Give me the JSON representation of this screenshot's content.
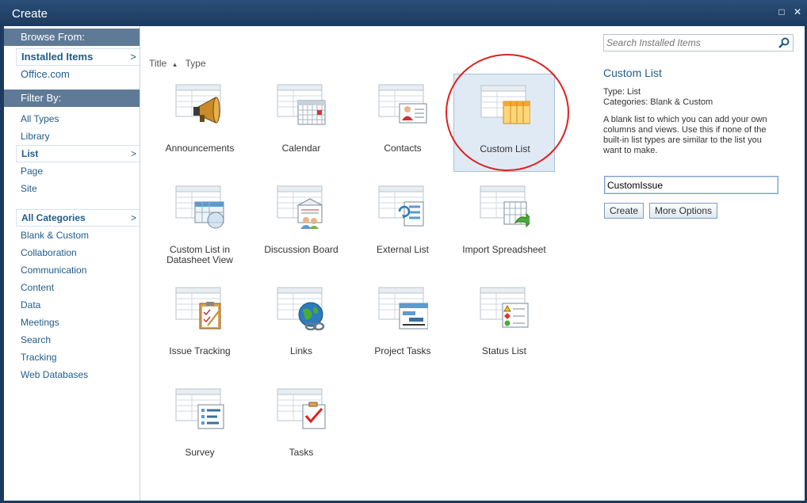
{
  "window": {
    "title": "Create",
    "maximize_glyph": "□",
    "close_glyph": "✕"
  },
  "nav": {
    "browse_header": "Browse From:",
    "browse": [
      {
        "label": "Installed Items",
        "selected": true
      },
      {
        "label": "Office.com",
        "selected": false
      }
    ],
    "filter_header": "Filter By:",
    "types": [
      {
        "label": "All Types",
        "selected": false
      },
      {
        "label": "Library",
        "selected": false
      },
      {
        "label": "List",
        "selected": true
      },
      {
        "label": "Page",
        "selected": false
      },
      {
        "label": "Site",
        "selected": false
      }
    ],
    "categories": [
      {
        "label": "All Categories",
        "selected": true
      },
      {
        "label": "Blank & Custom",
        "selected": false
      },
      {
        "label": "Collaboration",
        "selected": false
      },
      {
        "label": "Communication",
        "selected": false
      },
      {
        "label": "Content",
        "selected": false
      },
      {
        "label": "Data",
        "selected": false
      },
      {
        "label": "Meetings",
        "selected": false
      },
      {
        "label": "Search",
        "selected": false
      },
      {
        "label": "Tracking",
        "selected": false
      },
      {
        "label": "Web Databases",
        "selected": false
      }
    ],
    "chevron": ">"
  },
  "sort": {
    "title": "Title",
    "arrow": "▲",
    "type": "Type"
  },
  "tiles": [
    {
      "label": "Announcements",
      "icon": "megaphone-icon"
    },
    {
      "label": "Calendar",
      "icon": "calendar-icon"
    },
    {
      "label": "Contacts",
      "icon": "contact-card-icon"
    },
    {
      "label": "Custom List",
      "icon": "custom-list-icon",
      "selected": true
    },
    {
      "label": "Custom List in Datasheet View",
      "icon": "datasheet-icon"
    },
    {
      "label": "Discussion Board",
      "icon": "discussion-icon"
    },
    {
      "label": "External List",
      "icon": "external-list-icon"
    },
    {
      "label": "Import Spreadsheet",
      "icon": "spreadsheet-import-icon"
    },
    {
      "label": "Issue Tracking",
      "icon": "issue-clipboard-icon"
    },
    {
      "label": "Links",
      "icon": "globe-link-icon"
    },
    {
      "label": "Project Tasks",
      "icon": "gantt-icon"
    },
    {
      "label": "Status List",
      "icon": "status-indicator-icon"
    },
    {
      "label": "Survey",
      "icon": "survey-icon"
    },
    {
      "label": "Tasks",
      "icon": "task-checkbox-icon"
    }
  ],
  "details": {
    "search_placeholder": "Search Installed Items",
    "title": "Custom List",
    "type_line": "Type: List",
    "categories_line": "Categories: Blank & Custom",
    "description": "A blank list to which you can add your own columns and views. Use this if none of the built-in list types are similar to the list you want to make.",
    "name_value": "CustomIssue",
    "create_label": "Create",
    "more_options_label": "More Options"
  },
  "colors": {
    "title_bar": "#1c3a5e",
    "nav_header": "#5f7a97",
    "link": "#1f5c8b",
    "highlight_circle": "#dd2222",
    "selected_tile": "#dfeaf5"
  }
}
